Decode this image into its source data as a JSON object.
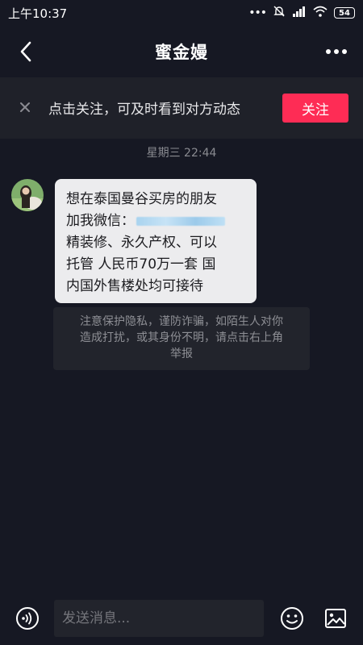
{
  "status_bar": {
    "time": "上午10:37",
    "battery": "54",
    "icons": [
      "dots-icon",
      "mute-icon",
      "signal-icon",
      "wifi-icon",
      "battery-icon"
    ]
  },
  "header": {
    "title": "蜜金嫚",
    "back_icon": "chevron-left-icon",
    "more_icon": "more-dots-icon"
  },
  "follow_bar": {
    "text": "点击关注，可及时看到对方动态",
    "button_label": "关注",
    "button_color": "#fe2c55"
  },
  "chat": {
    "timestamp": "星期三 22:44",
    "message": {
      "lines": [
        "想在泰国曼谷买房的朋友",
        "加我微信：",
        "精装修、永久产权、可以",
        "托管 人民币70万一套 国",
        "内国外售楼处均可接待"
      ]
    },
    "warning": {
      "lines": [
        "注意保护隐私，谨防诈骗，如陌生人对你",
        "造成打扰，或其身份不明，请点击右上角",
        "举报"
      ]
    }
  },
  "composer": {
    "placeholder": "发送消息...",
    "voice_icon": "voice-icon",
    "emoji_icon": "emoji-icon",
    "image_icon": "image-icon"
  }
}
